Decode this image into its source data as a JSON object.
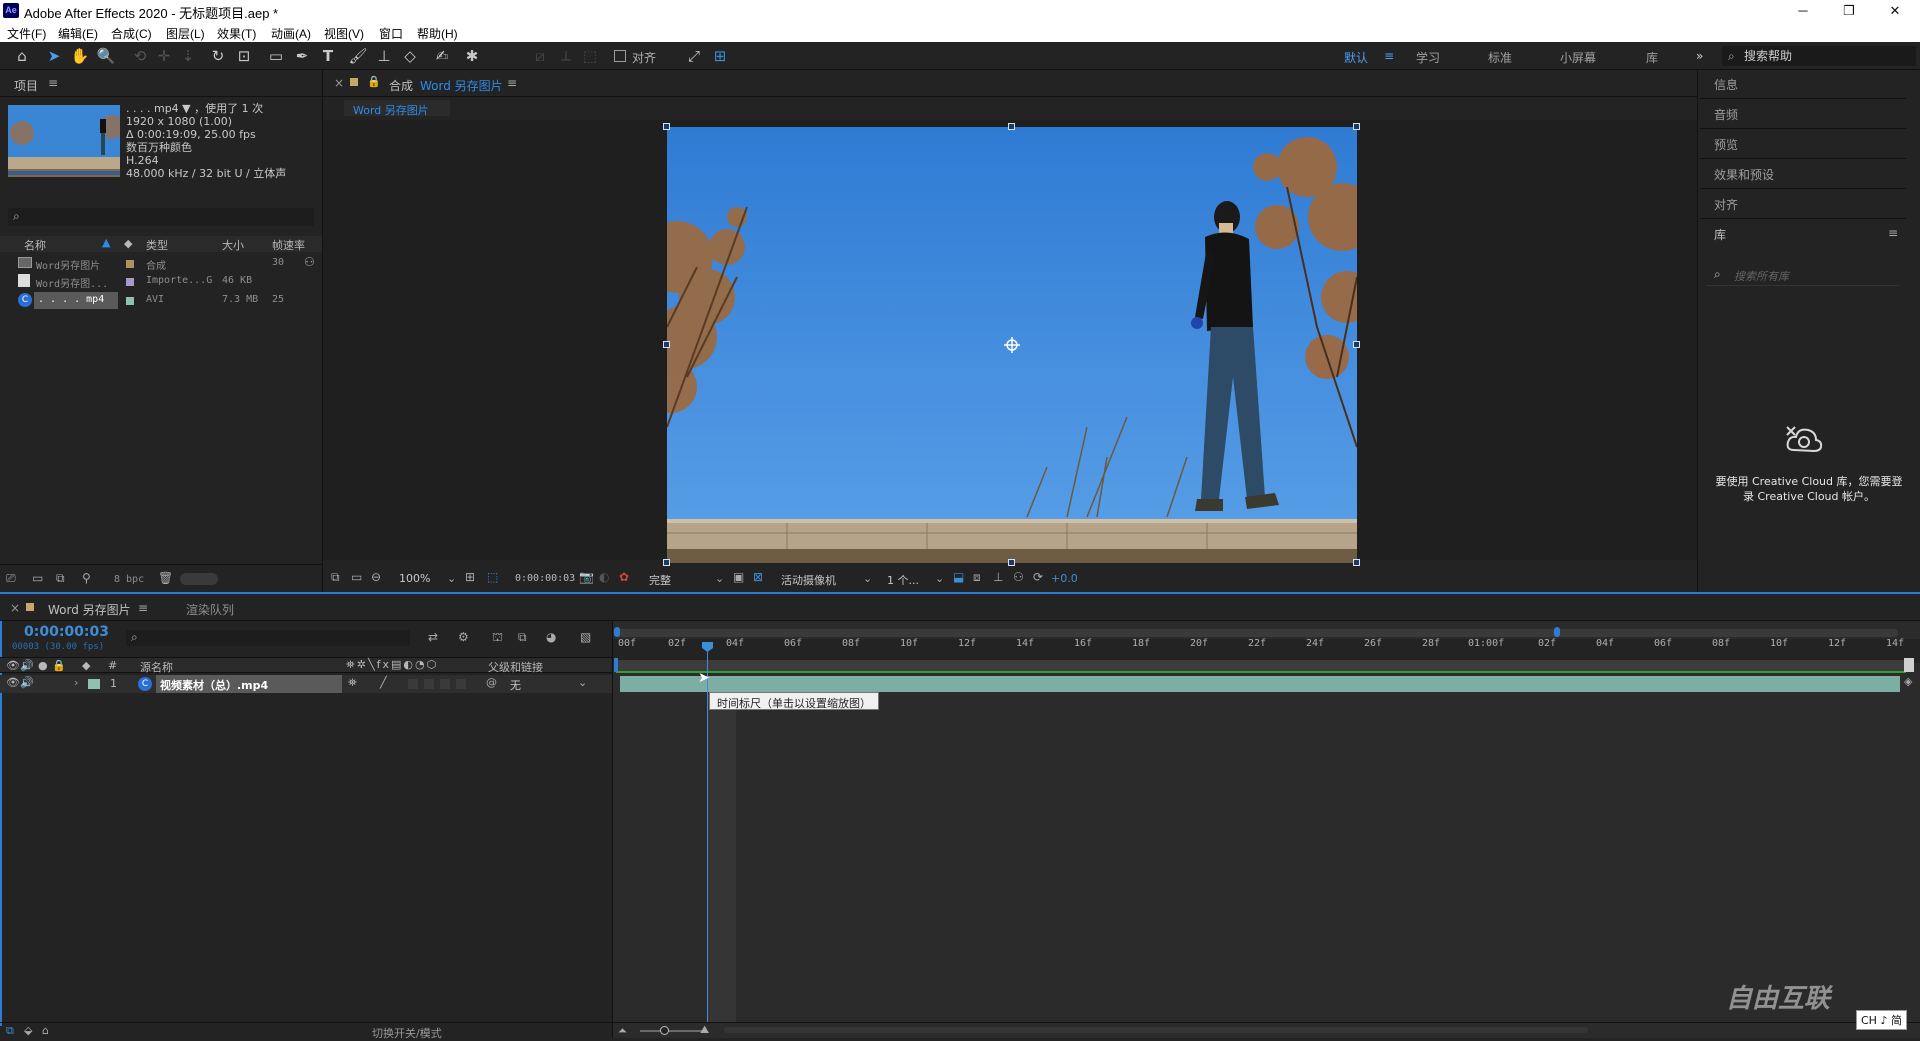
{
  "window": {
    "title": "Adobe After Effects 2020 - 无标题项目.aep *",
    "app_icon": "Ae",
    "controls": [
      "minimize-icon",
      "restore-icon",
      "close-icon"
    ]
  },
  "menu": [
    "文件(F)",
    "编辑(E)",
    "合成(C)",
    "图层(L)",
    "效果(T)",
    "动画(A)",
    "视图(V)",
    "窗口",
    "帮助(H)"
  ],
  "toolbar": {
    "align_label": "对齐",
    "workspaces": [
      "默认",
      "学习",
      "标准",
      "小屏幕",
      "库"
    ],
    "active_workspace": "默认",
    "overflow": "»",
    "search_help": "搜索帮助"
  },
  "project": {
    "title": "项目",
    "selected_name": ". . . . mp4 ▼ ，使用了 1 次",
    "meta": [
      "1920 x 1080 (1.00)",
      "Δ 0:00:19:09, 25.00 fps",
      "数百万种颜色",
      "H.264",
      "48.000 kHz / 32 bit U / 立体声"
    ],
    "search_placeholder": "",
    "columns": [
      "名称",
      "类型",
      "大小",
      "帧速率"
    ],
    "items": [
      {
        "name": "Word另存图片",
        "type": "合成",
        "size": "",
        "fps": "30",
        "color": "#b09060"
      },
      {
        "name": "Word另存图...",
        "type": "Importe...G",
        "size": "46 KB",
        "fps": "",
        "color": "#a89ac8"
      },
      {
        "name": ". . . . mp4",
        "type": "AVI",
        "size": "7.3 MB",
        "fps": "25",
        "color": "#8fc0b0"
      }
    ],
    "bpc": "8 bpc"
  },
  "composition": {
    "tab_prefix": "合成",
    "tab_name": "Word 另存图片",
    "subtab": "Word 另存图片",
    "zoom": "100%",
    "timecode": "0:00:00:03",
    "quality": "完整",
    "camera": "活动摄像机",
    "views": "1 个...",
    "exposure": "+0.0"
  },
  "right_panel": {
    "items": [
      "信息",
      "音频",
      "预览",
      "效果和预设",
      "对齐"
    ],
    "library_title": "库",
    "library_search": "搜索所有库",
    "cc_message_line1": "要使用 Creative Cloud 库，您需要登",
    "cc_message_line2": "录 Creative Cloud 帐户。"
  },
  "timeline": {
    "tab_name": "Word 另存图片",
    "render_queue": "渲染队列",
    "current_time": "0:00:00:03",
    "frame_info": "00003 (30.00 fps)",
    "columns": {
      "source": "源名称",
      "parent": "父级和链接",
      "num": "#"
    },
    "layer": {
      "num": "1",
      "name": "视频素材（总）.mp4",
      "parent": "无"
    },
    "ruler": [
      "00f",
      "02f",
      "04f",
      "06f",
      "08f",
      "10f",
      "12f",
      "14f",
      "16f",
      "18f",
      "20f",
      "22f",
      "24f",
      "26f",
      "28f",
      "01:00f",
      "02f",
      "04f",
      "06f",
      "08f",
      "10f",
      "12f",
      "14f"
    ],
    "tooltip": "时间标尺（单击以设置缩放图）",
    "footer": "切换开关/模式"
  },
  "watermark": {
    "text": "自由互联",
    "ime": "CH ♪ 简"
  }
}
